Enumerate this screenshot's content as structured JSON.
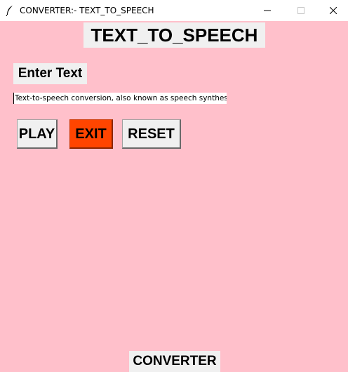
{
  "window": {
    "title": "CONVERTER:- TEXT_TO_SPEECH",
    "app_icon": "feather-icon",
    "controls": [
      "minimize-icon",
      "maximize-icon",
      "close-icon"
    ]
  },
  "main": {
    "heading": "TEXT_TO_SPEECH",
    "input_label": "Enter Text",
    "text_value": "Text-to-speech conversion, also known as speech synthes",
    "buttons": {
      "play": "PLAY",
      "exit": "EXIT",
      "reset": "RESET"
    },
    "footer": "CONVERTER"
  },
  "colors": {
    "background": "#ffc0cb",
    "label_bg": "#f0f0f0",
    "exit_bg": "#ff4500"
  }
}
